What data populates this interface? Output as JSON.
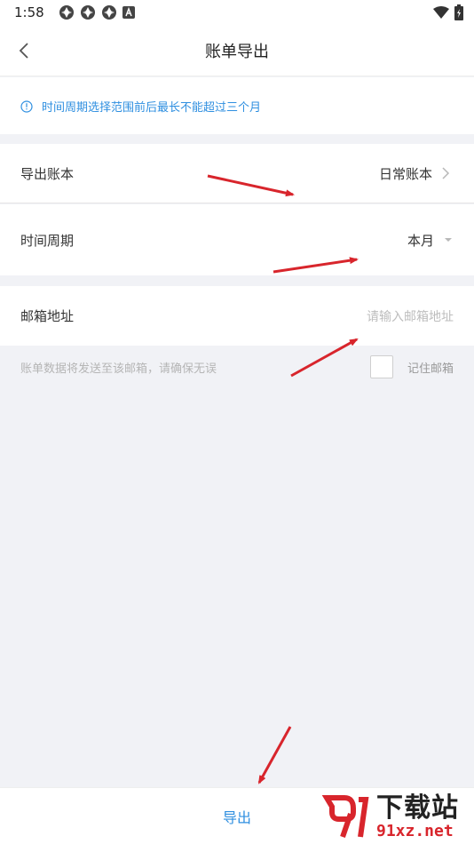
{
  "status_bar": {
    "time": "1:58",
    "left_icons": [
      "app-notification-icon",
      "app-notification-icon",
      "app-notification-icon",
      "a-icon"
    ],
    "right_icons": [
      "wifi-icon",
      "battery-icon"
    ]
  },
  "header": {
    "title": "账单导出",
    "back_icon": "chevron-left-icon"
  },
  "notice": {
    "icon": "info-circle-icon",
    "text": "时间周期选择范围前后最长不能超过三个月",
    "color": "#2f8fe0"
  },
  "form": {
    "account": {
      "label": "导出账本",
      "value": "日常账本"
    },
    "period": {
      "label": "时间周期",
      "value": "本月"
    },
    "email": {
      "label": "邮箱地址",
      "placeholder": "请输入邮箱地址"
    },
    "hint": "账单数据将发送至该邮箱，请确保无误",
    "remember_label": "记住邮箱"
  },
  "footer": {
    "export_label": "导出"
  },
  "watermark": {
    "big_text": "下载站",
    "small_text": "91xz.net"
  },
  "colors": {
    "accent": "#2f8fe0",
    "background": "#f1f2f6",
    "arrow": "#d8252c"
  }
}
